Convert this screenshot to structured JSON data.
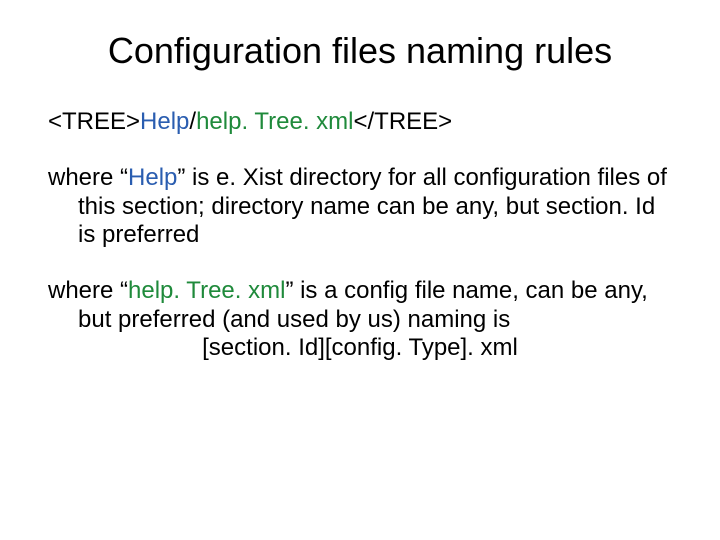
{
  "title": "Configuration files naming rules",
  "tree": {
    "open": "<TREE>",
    "dir": "Help",
    "sep": "/",
    "file": "help. Tree. xml",
    "close": "</TREE>"
  },
  "p1": {
    "lead": "where “",
    "hl": "Help",
    "rest": "” is e. Xist directory for all configuration files of this section; directory name can be any, but section. Id is preferred"
  },
  "p2": {
    "lead": "where “",
    "hl": "help. Tree. xml",
    "rest": "” is a config file name, can  be any, but preferred (and used by us) naming is"
  },
  "pattern": "[section. Id][config. Type]. xml"
}
